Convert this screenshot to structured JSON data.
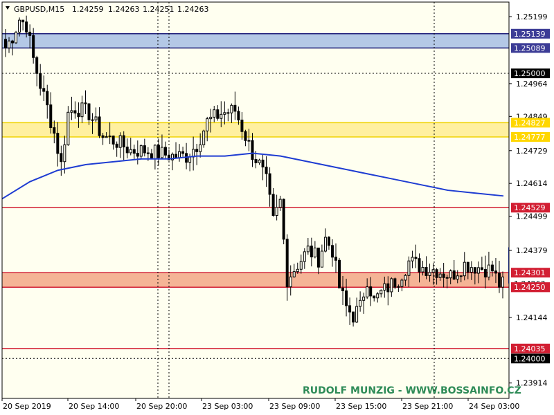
{
  "chart_data": {
    "type": "candlestick",
    "header": {
      "symbol": "GBPUSD,M15",
      "ohlc": [
        "1.24259",
        "1.24263",
        "1.24251",
        "1.24263"
      ]
    },
    "watermark": "RUDOLF MUNZIG - WWW.BOSSAINFO.CZ",
    "colors": {
      "background": "#fffff0",
      "frame": "#000000",
      "candle": "#000000",
      "moving_average": "#1e3cd2",
      "blue_zone": "#b4c8e6",
      "blue_zone_edge": "#1c1c78",
      "yellow_zone": "#fff0a0",
      "yellow_zone_edge": "#f0d200",
      "orange_zone": "#f5b496",
      "red_line": "#d21e32",
      "watermark": "#2e8b57"
    },
    "y_range": [
      1.2386,
      1.2525
    ],
    "y_ticks": [
      "1.25199",
      "1.24964",
      "1.24849",
      "1.24729",
      "1.24614",
      "1.24499",
      "1.24379",
      "1.24144",
      "1.23914"
    ],
    "x_ticks": [
      "20 Sep 2019",
      "20 Sep 14:00",
      "20 Sep 20:00",
      "23 Sep 03:00",
      "23 Sep 09:00",
      "23 Sep 15:00",
      "23 Sep 21:00",
      "24 Sep 03:00"
    ],
    "zones": [
      {
        "color": "blue",
        "top": 1.25139,
        "bottom": 1.25089,
        "top_label": "1.25139",
        "bottom_label": "1.25089"
      },
      {
        "color": "yellow",
        "top": 1.24827,
        "bottom": 1.24777,
        "top_label": "1.24827",
        "bottom_label": "1.24777"
      },
      {
        "color": "orange",
        "top": 1.24301,
        "bottom": 1.2425,
        "top_label": "1.24301",
        "bottom_label": "1.24250"
      }
    ],
    "levels": [
      {
        "value": 1.24529,
        "label": "1.24529",
        "kind": "red"
      },
      {
        "value": 1.24035,
        "label": "1.24035",
        "kind": "red"
      },
      {
        "value": 1.25,
        "label": "1.25000",
        "kind": "round"
      },
      {
        "value": 1.24,
        "label": "1.24000",
        "kind": "round"
      }
    ],
    "current_price": {
      "value": 1.24263,
      "label": "1.24263"
    },
    "moving_average": [
      1.2456,
      1.2462,
      1.2466,
      1.2468,
      1.2469,
      1.247,
      1.247,
      1.2471,
      1.2471,
      1.2472,
      1.2471,
      1.2469,
      1.2467,
      1.2465,
      1.2463,
      1.2461,
      1.2459,
      1.2458,
      1.2457
    ],
    "keypoints": [
      [
        0,
        1.2509
      ],
      [
        2,
        1.2513
      ],
      [
        4,
        1.2519
      ],
      [
        6,
        1.2517
      ],
      [
        8,
        1.2505
      ],
      [
        10,
        1.2496
      ],
      [
        12,
        1.2488
      ],
      [
        14,
        1.2479
      ],
      [
        16,
        1.2468
      ],
      [
        18,
        1.2486
      ],
      [
        20,
        1.2488
      ],
      [
        24,
        1.2486
      ],
      [
        28,
        1.2478
      ],
      [
        32,
        1.2476
      ],
      [
        36,
        1.2473
      ],
      [
        40,
        1.2473
      ],
      [
        44,
        1.2472
      ],
      [
        48,
        1.2471
      ],
      [
        52,
        1.2471
      ],
      [
        55,
        1.2475
      ],
      [
        58,
        1.2483
      ],
      [
        62,
        1.2486
      ],
      [
        66,
        1.2487
      ],
      [
        69,
        1.2478
      ],
      [
        71,
        1.2472
      ],
      [
        73,
        1.2468
      ],
      [
        75,
        1.2462
      ],
      [
        77,
        1.2448
      ],
      [
        79,
        1.2455
      ],
      [
        81,
        1.2428
      ],
      [
        84,
        1.2433
      ],
      [
        87,
        1.2438
      ],
      [
        90,
        1.2435
      ],
      [
        92,
        1.2442
      ],
      [
        94,
        1.2438
      ],
      [
        96,
        1.2425
      ],
      [
        98,
        1.2418
      ],
      [
        100,
        1.2415
      ],
      [
        102,
        1.2418
      ],
      [
        104,
        1.2428
      ],
      [
        106,
        1.242
      ],
      [
        108,
        1.2423
      ],
      [
        110,
        1.2425
      ],
      [
        113,
        1.2428
      ],
      [
        116,
        1.2434
      ],
      [
        120,
        1.2432
      ],
      [
        124,
        1.2431
      ],
      [
        128,
        1.2429
      ],
      [
        132,
        1.2433
      ],
      [
        136,
        1.2432
      ],
      [
        140,
        1.2431
      ],
      [
        142,
        1.2426
      ],
      [
        143,
        1.2426
      ]
    ]
  }
}
